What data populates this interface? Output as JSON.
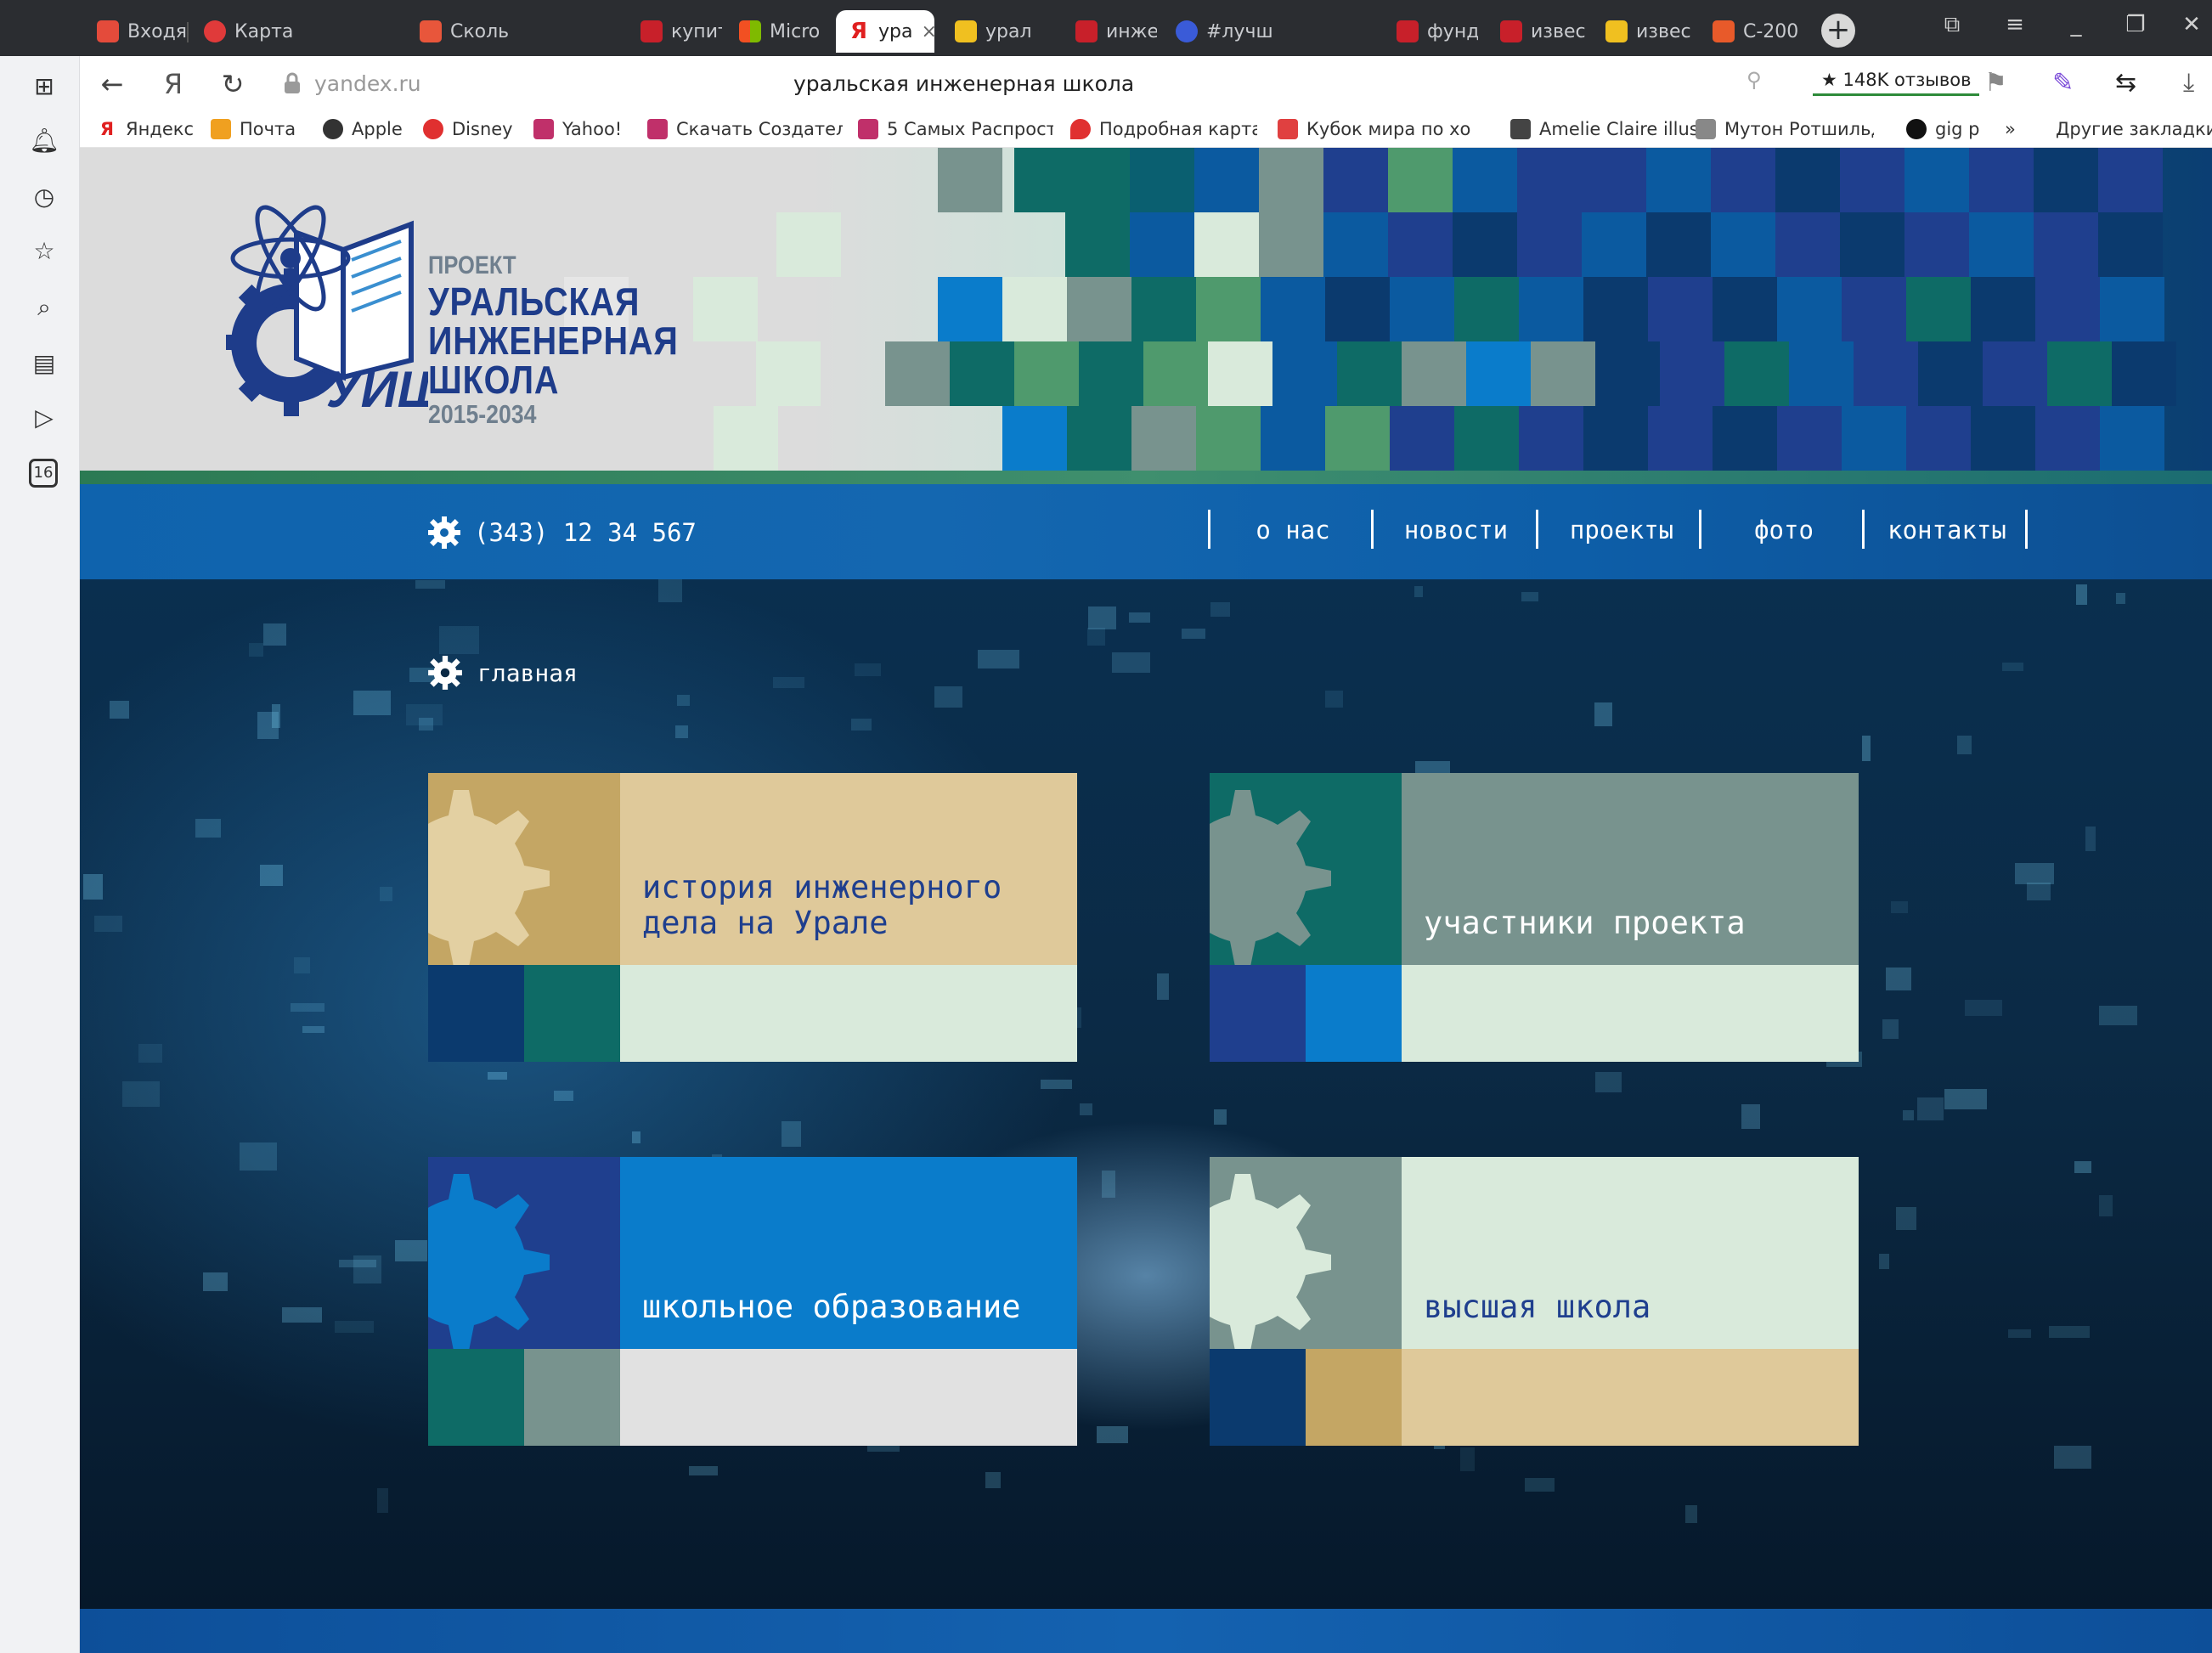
{
  "browser": {
    "tabs": [
      {
        "label": "Входя",
        "color": "#e44b3b"
      },
      {
        "label": "Карта",
        "color": "#e03a3a"
      },
      {
        "label": "Сколь",
        "color": "#e8563b"
      },
      {
        "label": "купит",
        "color": "#c8202a"
      },
      {
        "label": "Micro",
        "color": "#f2a31a"
      },
      {
        "label": "ура",
        "color": "#e02020",
        "active": true
      },
      {
        "label": "урал",
        "color": "#f0c020"
      },
      {
        "label": "инже",
        "color": "#c8202a"
      },
      {
        "label": "#лучш",
        "color": "#3a5bd8"
      },
      {
        "label": "фунд",
        "color": "#c8202a"
      },
      {
        "label": "извес",
        "color": "#c8202a"
      },
      {
        "label": "извес",
        "color": "#f0c020"
      },
      {
        "label": "С-200",
        "color": "#e85a2a"
      }
    ],
    "tab_close": "×",
    "new_tab": "+",
    "address": {
      "host": "yandex.ru",
      "page_title": "уральская инженерная школа",
      "reviews": "★ 148K отзывов"
    },
    "bookmarks": [
      {
        "label": "Яндекс",
        "color": "#e02020"
      },
      {
        "label": "Почта",
        "color": "#f0a020"
      },
      {
        "label": "Apple",
        "color": "#333333"
      },
      {
        "label": "Disney",
        "color": "#e03030"
      },
      {
        "label": "Yahoo!",
        "color": "#c0306a"
      },
      {
        "label": "Скачать Создател",
        "color": "#c0306a"
      },
      {
        "label": "5 Самых Распрост",
        "color": "#c0306a"
      },
      {
        "label": "Подробная карта",
        "color": "#e03030"
      },
      {
        "label": "Кубок мира по хо",
        "color": "#e04040"
      },
      {
        "label": "Amelie Claire illust",
        "color": "#444444"
      },
      {
        "label": "Мутон Ротшильд",
        "color": "#888888"
      },
      {
        "label": "gig p",
        "color": "#111111"
      }
    ],
    "bookmarks_more": "»",
    "other_bookmarks": "Другие закладки",
    "side_badge": "16"
  },
  "site": {
    "logo": {
      "proekt": "ПРОЕКТ",
      "line1": "УРАЛЬСКАЯ",
      "line2": "ИНЖЕНЕРНАЯ",
      "line3": "ШКОЛА",
      "years": "2015-2034",
      "emblem_letters": "УИШ"
    },
    "phone": "(343) 12 34 567",
    "nav": [
      "о нас",
      "новости",
      "проекты",
      "фото",
      "контакты"
    ],
    "breadcrumb": "главная",
    "tiles": [
      {
        "label": "история инженерного\nдела на Урале"
      },
      {
        "label": "участники проекта"
      },
      {
        "label": "школьное образование"
      },
      {
        "label": "высшая школа"
      }
    ]
  },
  "colors": {
    "navy": "#0b3a6e",
    "teal": "#0e6b66",
    "blue": "#0a7ccb",
    "sage": "#78938e",
    "mint": "#d9eadb",
    "sand": "#dfc99a",
    "gold": "#c4a664",
    "royal": "#1f3f8e",
    "lightgray": "#e1e1e1"
  }
}
